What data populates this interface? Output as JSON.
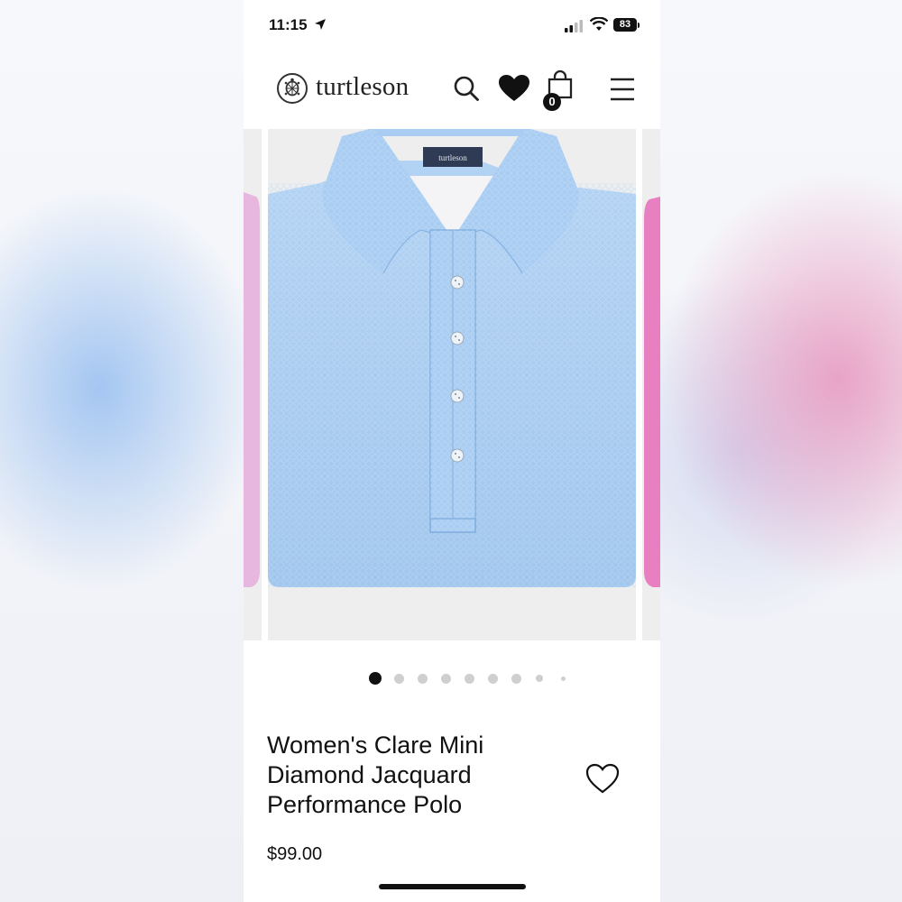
{
  "status_bar": {
    "time": "11:15",
    "battery": "83"
  },
  "header": {
    "brand": "turtleson",
    "cart_count": "0"
  },
  "product_image": {
    "label_tag": "turtleson",
    "color": "#a9cdf2"
  },
  "side_slides": {
    "prev_color": "#e8b7e0",
    "next_color": "#e87fc0"
  },
  "gallery": {
    "total_dots": 9,
    "active_index": 0
  },
  "product": {
    "title": "Women's Clare Mini Diamond Jacquard Performance Polo",
    "price": "$99.00"
  }
}
